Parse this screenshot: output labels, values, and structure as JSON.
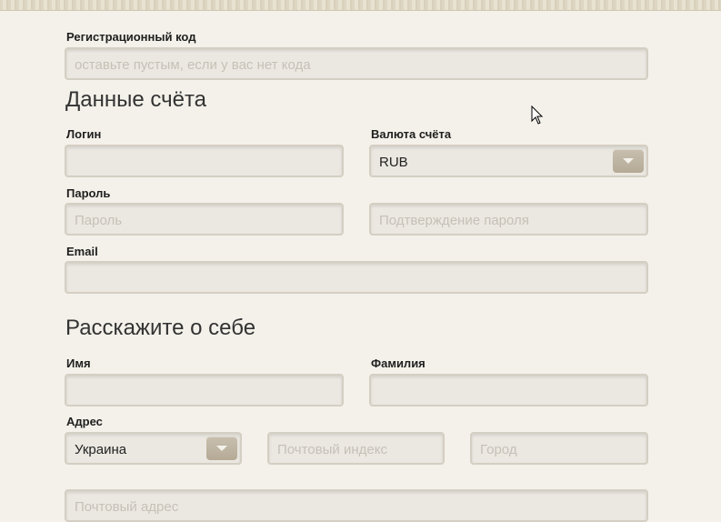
{
  "registration": {
    "label": "Регистрационный код",
    "placeholder": "оставьте пустым, если у вас нет кода"
  },
  "account": {
    "heading": "Данные счёта",
    "login_label": "Логин",
    "currency_label": "Валюта счёта",
    "currency_value": "RUB",
    "password_label": "Пароль",
    "password_placeholder": "Пароль",
    "password_confirm_placeholder": "Подтверждение пароля",
    "email_label": "Email"
  },
  "about": {
    "heading": "Расскажите о себе",
    "first_name_label": "Имя",
    "last_name_label": "Фамилия",
    "address_label": "Адрес",
    "country_value": "Украина",
    "postal_code_placeholder": "Почтовый индекс",
    "city_placeholder": "Город",
    "postal_address_placeholder": "Почтовый адрес"
  },
  "icons": {
    "dropdown": "chevron-down-icon",
    "cursor": "mouse-pointer-icon"
  }
}
